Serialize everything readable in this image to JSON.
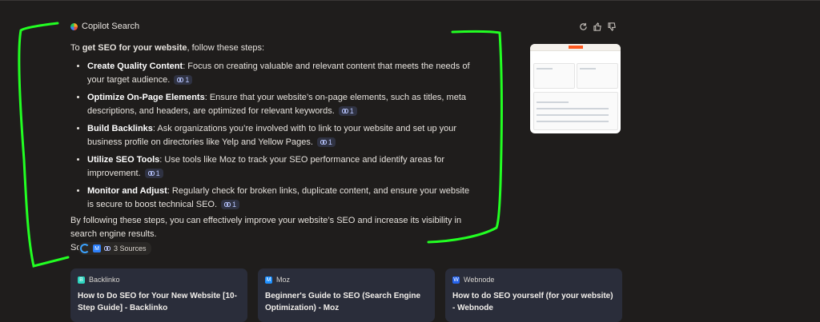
{
  "header": {
    "title": "Copilot Search"
  },
  "actions": {
    "labels": [
      "refresh",
      "thumbs-up",
      "thumbs-down"
    ]
  },
  "answer": {
    "intro_prefix": "To ",
    "intro_bold": "get SEO for your website",
    "intro_suffix": ", follow these steps:",
    "steps": [
      {
        "title": "Create Quality Content",
        "text": ": Focus on creating valuable and relevant content that meets the needs of your target audience.",
        "cite": "1"
      },
      {
        "title": "Optimize On-Page Elements",
        "text": ": Ensure that your website’s on-page elements, such as titles, meta descriptions, and headers, are optimized for relevant keywords.",
        "cite": "1"
      },
      {
        "title": "Build Backlinks",
        "text": ": Ask organizations you’re involved with to link to your website and set up your business profile on directories like Yelp and Yellow Pages.",
        "cite": "1"
      },
      {
        "title": "Utilize SEO Tools",
        "text": ": Use tools like Moz to track your SEO performance and identify areas for improvement.",
        "cite": "1"
      },
      {
        "title": "Monitor and Adjust",
        "text": ": Regularly check for broken links, duplicate content, and ensure your website is secure to boost technical SEO.",
        "cite": "1"
      }
    ],
    "summary": "By following these steps, you can effectively improve your website’s SEO and increase its visibility in search engine results.",
    "sources_label": "Sources:,,",
    "sources_cite": "3"
  },
  "sources_chip": {
    "label": "3 Sources"
  },
  "cards": [
    {
      "site": "Backlinko",
      "title": "How to Do SEO for Your New Website [10-Step Guide] - Backlinko",
      "color": "#2dd4bf"
    },
    {
      "site": "Moz",
      "title": "Beginner's Guide to SEO (Search Engine Optimization) - Moz",
      "color": "#1e90ff"
    },
    {
      "site": "Webnode",
      "title": "How to do SEO yourself (for your website) - Webnode",
      "color": "#2563eb"
    }
  ],
  "colors": {
    "background": "#1f1d1c",
    "card": "#2a2d3a",
    "annotation": "#22ff22"
  }
}
